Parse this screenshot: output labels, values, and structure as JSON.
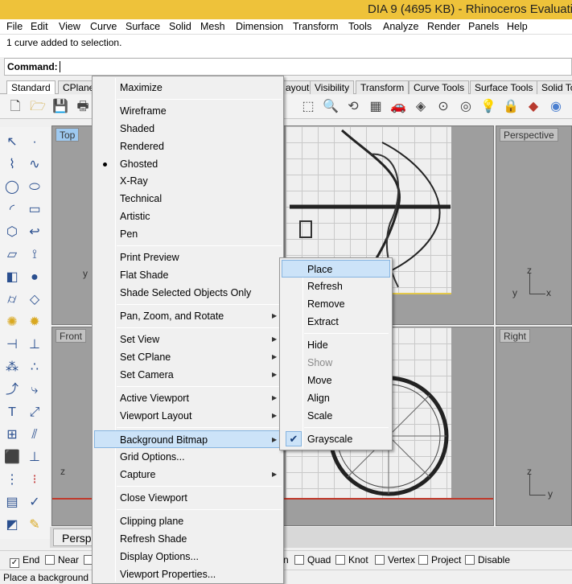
{
  "window": {
    "title": "DIA 9 (4695 KB) - Rhinoceros Evaluatio"
  },
  "menubar": [
    "File",
    "Edit",
    "View",
    "Curve",
    "Surface",
    "Solid",
    "Mesh",
    "Dimension",
    "Transform",
    "Tools",
    "Analyze",
    "Render",
    "Panels",
    "Help"
  ],
  "history": {
    "line": "1 curve added to selection."
  },
  "command": {
    "label": "Command:"
  },
  "toolbar_tabs": [
    "Standard",
    "CPlane",
    "ayout",
    "Visibility",
    "Transform",
    "Curve Tools",
    "Surface Tools",
    "Solid To"
  ],
  "viewports": {
    "top": "Top",
    "perspective": "Perspective",
    "front": "Front",
    "right": "Right",
    "bottom_tab": "Persp"
  },
  "axes": {
    "x": "x",
    "y": "y",
    "z": "z"
  },
  "context_menu": {
    "items": [
      "Maximize",
      "Wireframe",
      "Shaded",
      "Rendered",
      "Ghosted",
      "X-Ray",
      "Technical",
      "Artistic",
      "Pen",
      "Print Preview",
      "Flat Shade",
      "Shade Selected Objects Only",
      "Pan, Zoom, and Rotate",
      "Set View",
      "Set CPlane",
      "Set Camera",
      "Active Viewport",
      "Viewport Layout",
      "Background Bitmap",
      "Grid Options...",
      "Capture",
      "Close Viewport",
      "Clipping plane",
      "Refresh Shade",
      "Display Options...",
      "Viewport Properties..."
    ],
    "checked": "Ghosted",
    "highlighted": "Background Bitmap"
  },
  "submenu": {
    "items": [
      "Place",
      "Refresh",
      "Remove",
      "Extract",
      "Hide",
      "Show",
      "Move",
      "Align",
      "Scale",
      "Grayscale"
    ],
    "highlighted": "Place",
    "disabled": "Show",
    "checked": "Grayscale"
  },
  "osnap": {
    "items": [
      "End",
      "Near",
      "n",
      "Quad",
      "Knot",
      "Vertex",
      "Project",
      "Disable"
    ],
    "checked": "End"
  },
  "status": {
    "prompt": "Place a background"
  },
  "colors": {
    "titlebar": "#eec23a",
    "highlight": "#cce3f8",
    "ground_line": "#e4c94a"
  }
}
